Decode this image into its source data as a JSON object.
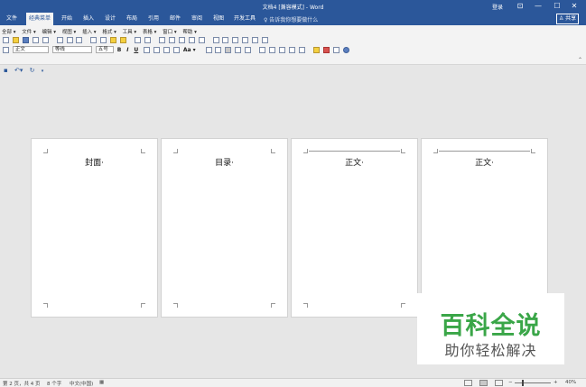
{
  "window": {
    "title": "文档4 [兼容模式] - Word",
    "login": "登录",
    "controls": [
      "⊡",
      "—",
      "☐",
      "✕"
    ]
  },
  "ribbon_tabs": [
    "文件",
    "经典菜单",
    "开始",
    "插入",
    "设计",
    "布局",
    "引用",
    "邮件",
    "审阅",
    "视图",
    "开发工具"
  ],
  "active_tab": "经典菜单",
  "tell_me": "♀ 告诉我你想要做什么",
  "share_label": "♙ 共享",
  "classic_menu": [
    "全部 ▾",
    "文件 ▾",
    "编辑 ▾",
    "视图 ▾",
    "插入 ▾",
    "格式 ▾",
    "工具 ▾",
    "表格 ▾",
    "窗口 ▾",
    "帮助 ▾"
  ],
  "format_bar": {
    "style": "正文",
    "font": "等线",
    "size": "五号",
    "bold": "B",
    "italic": "I",
    "underline": "U",
    "font_case": "Aa ▾"
  },
  "quick_access": [
    "save-icon",
    "undo-icon",
    "redo-icon",
    "customize-icon"
  ],
  "pages": [
    {
      "title": "封面·",
      "header_line": false
    },
    {
      "title": "目录·",
      "header_line": false
    },
    {
      "title": "正文·",
      "header_line": true
    },
    {
      "title": "正文·",
      "header_line": true
    }
  ],
  "watermark": {
    "main": "百科全说",
    "sub": "助你轻松解决"
  },
  "status": {
    "page": "第 2 页，共 4 页",
    "words": "8 个字",
    "language": "中文(中国)",
    "zoom": "40%"
  },
  "colors": {
    "brand": "#2b579a",
    "watermark_green": "#3aa648"
  }
}
